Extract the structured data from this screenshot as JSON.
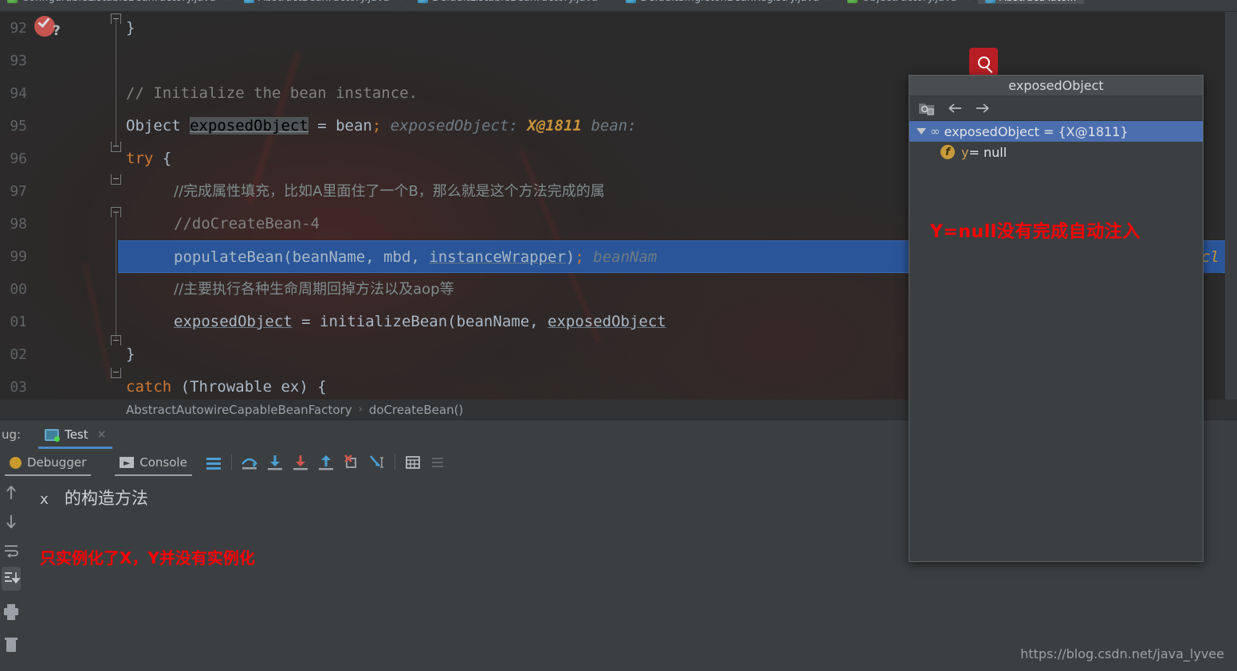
{
  "tabs": [
    {
      "label": "ConfigurableListableBeanFactory.java",
      "icon": "java-class-icon",
      "color": "green",
      "active": false
    },
    {
      "label": "AbstractBeanFactory.java",
      "icon": "java-abstract-class-icon",
      "color": "blue",
      "active": false
    },
    {
      "label": "DefaultListableBeanFactory.java",
      "icon": "java-class-icon",
      "color": "blue",
      "active": false
    },
    {
      "label": "DefaultSingletonBeanRegistry.java",
      "icon": "java-class-icon",
      "color": "blue",
      "active": false
    },
    {
      "label": "ObjectFactory.java",
      "icon": "java-interface-icon",
      "color": "green",
      "active": false
    },
    {
      "label": "AbstractAuto...",
      "icon": "java-abstract-class-icon",
      "color": "blue",
      "active": true
    }
  ],
  "editor": {
    "line_numbers": [
      "92",
      "93",
      "94",
      "95",
      "96",
      "97",
      "98",
      "99",
      "00",
      "01",
      "02",
      "03"
    ],
    "breakpoint": {
      "name": "breakpoint-icon",
      "marker": "?"
    },
    "lines": [
      {
        "num": "92",
        "segments": [
          {
            "text": "}",
            "cls": "plain"
          }
        ],
        "indent": 0
      },
      {
        "num": "93",
        "segments": [],
        "indent": 0
      },
      {
        "num": "94",
        "segments": [
          {
            "text": "// Initialize the bean instance.",
            "cls": "cmt"
          }
        ],
        "indent": 0
      },
      {
        "num": "95",
        "segments": [
          {
            "text": "Object ",
            "cls": "plain"
          },
          {
            "text": "exposedObject",
            "cls": "hlword"
          },
          {
            "text": " = bean",
            "cls": "plain"
          },
          {
            "text": ";",
            "cls": "sem"
          },
          {
            "text": "   exposedObject: ",
            "cls": "hint"
          },
          {
            "text": "X@1811",
            "cls": "hintval"
          },
          {
            "text": "   bean:",
            "cls": "hint"
          }
        ],
        "indent": 0
      },
      {
        "num": "96",
        "segments": [
          {
            "text": "try",
            "cls": "kw"
          },
          {
            "text": " {",
            "cls": "plain"
          }
        ],
        "indent": 0
      },
      {
        "num": "97",
        "segments": [
          {
            "text": "//完成属性填充，比如A里面住了一个B，那么就是这个方法完成的属",
            "cls": "cmt-cn"
          }
        ],
        "indent": 1
      },
      {
        "num": "98",
        "segments": [
          {
            "text": "//doCreateBean-4",
            "cls": "cmt"
          }
        ],
        "indent": 1
      },
      {
        "num": "99",
        "highlighted": true,
        "segments": [
          {
            "text": "populateBean",
            "cls": "plain"
          },
          {
            "text": "(beanName, mbd, ",
            "cls": "plain"
          },
          {
            "text": "instanceWrapper",
            "cls": "fld"
          },
          {
            "text": ")",
            "cls": "plain"
          },
          {
            "text": ";",
            "cls": "sem"
          },
          {
            "text": "   beanNam",
            "cls": "hint"
          }
        ],
        "indent": 1
      },
      {
        "num": "00",
        "segments": [
          {
            "text": "//主要执行各种生命周期回掉方法以及aop等",
            "cls": "cmt-cn"
          }
        ],
        "indent": 1
      },
      {
        "num": "01",
        "segments": [
          {
            "text": "exposedObject",
            "cls": "fld"
          },
          {
            "text": " = initializeBean(beanName, ",
            "cls": "plain"
          },
          {
            "text": "exposedObject",
            "cls": "fld"
          }
        ],
        "indent": 1
      },
      {
        "num": "02",
        "segments": [
          {
            "text": "}",
            "cls": "plain"
          }
        ],
        "indent": 0
      },
      {
        "num": "03",
        "segments": [
          {
            "text": "catch",
            "cls": "kw"
          },
          {
            "text": " (Throwable ex) {",
            "cls": "plain"
          }
        ],
        "indent": 0
      }
    ],
    "overflow_right_text": "cl"
  },
  "breadcrumb": {
    "class_name": "AbstractAutowireCapableBeanFactory",
    "separator": "›",
    "method_name": "doCreateBean()"
  },
  "debug_window": {
    "label": "ug:",
    "run_tab": {
      "label": "Test",
      "close": "×",
      "icon": "run-config-icon"
    },
    "tabs": [
      {
        "label": "Debugger",
        "icon": "bug-icon",
        "selected": true
      },
      {
        "label": "Console",
        "icon": "console-icon",
        "selected": true
      }
    ],
    "toolbar_icons": [
      "frames-icon",
      "step-over-icon",
      "step-into-icon",
      "force-step-into-icon",
      "step-out-icon",
      "drop-frame-icon",
      "run-to-cursor-icon",
      "evaluate-expression-icon",
      "settings-icon"
    ],
    "side_icons": [
      "scroll-up-icon",
      "scroll-down-icon",
      "soft-wrap-icon",
      "scroll-to-end-icon",
      "print-icon",
      "clear-all-icon"
    ]
  },
  "console": {
    "output_prefix": "x",
    "output_text": "的构造方法",
    "annotation": "只实例化了X，Y并没有实例化",
    "watermark": "https://blog.csdn.net/java_lyvee"
  },
  "popup": {
    "title": "exposedObject",
    "toolbar_icons": [
      "show-referring-objects-icon",
      "back-arrow-icon",
      "forward-arrow-icon"
    ],
    "rows": [
      {
        "indent": 0,
        "expander": "▼",
        "icon": "glasses-icon",
        "label": "exposedObject = {X@1811}",
        "selected": true
      },
      {
        "indent": 1,
        "expander": "",
        "icon": "field-icon",
        "name": "y",
        "label": " = null",
        "selected": false
      }
    ],
    "annotation": "Y=null没有完成自动注入"
  },
  "search_badge": {
    "name": "search-icon"
  },
  "colors": {
    "accent_blue": "#4b6eaf",
    "highlight_line": "#2a5699",
    "annotation_red": "#ff0000",
    "badge_red": "#b81f24",
    "panel_bg": "#3c3f41",
    "editor_bg": "#2b2b2b"
  }
}
